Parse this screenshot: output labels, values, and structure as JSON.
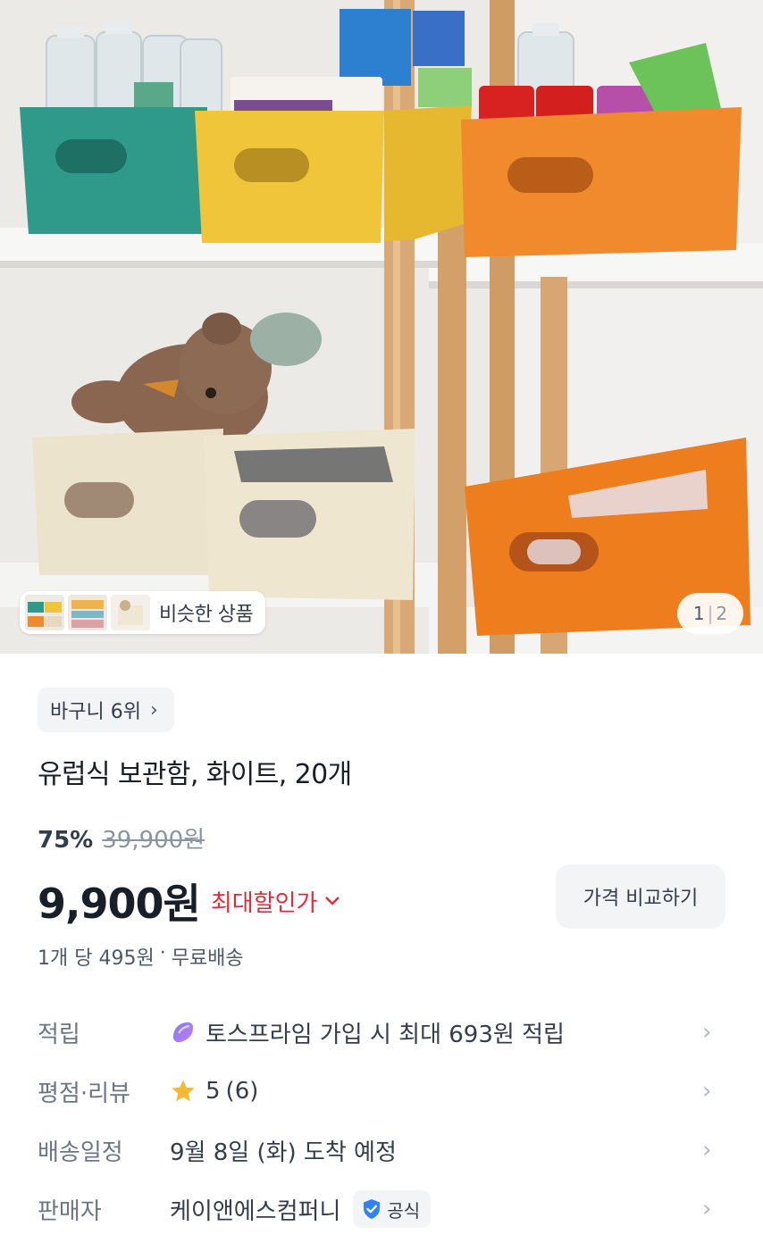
{
  "gallery": {
    "similar_label": "비슷한 상품",
    "page_current": "1",
    "page_separator": "|",
    "page_total": "2"
  },
  "product": {
    "rank_label": "바구니 6위",
    "title": "유럽식 보관함, 화이트, 20개",
    "discount_rate": "75%",
    "original_price": "39,900원",
    "sale_price": "9,900원",
    "max_discount_label": "최대할인가",
    "compare_button_label": "가격 비교하기",
    "unit_price": "1개 당 495원",
    "dot": "·",
    "shipping": "무료배송"
  },
  "details": {
    "points": {
      "label": "적립",
      "value": "토스프라임 가입 시 최대 693원 적립"
    },
    "rating": {
      "label": "평점·리뷰",
      "score": "5",
      "count": "(6)"
    },
    "delivery": {
      "label": "배송일정",
      "value": "9월 8일 (화) 도착 예정"
    },
    "seller": {
      "label": "판매자",
      "value": "케이앤에스컴퍼니",
      "badge": "공식"
    }
  },
  "colors": {
    "accent_red": "#e42939",
    "star_yellow": "#f5b82e",
    "official_blue": "#3182f6",
    "teal_bin": "#2f9a8a",
    "yellow_bin": "#f0c53a",
    "orange_bin": "#f08a2c"
  },
  "icons": {
    "points": "toss-prime-icon",
    "rating": "star-icon",
    "official": "shield-check-icon",
    "chevron": "chevron-right-icon"
  }
}
